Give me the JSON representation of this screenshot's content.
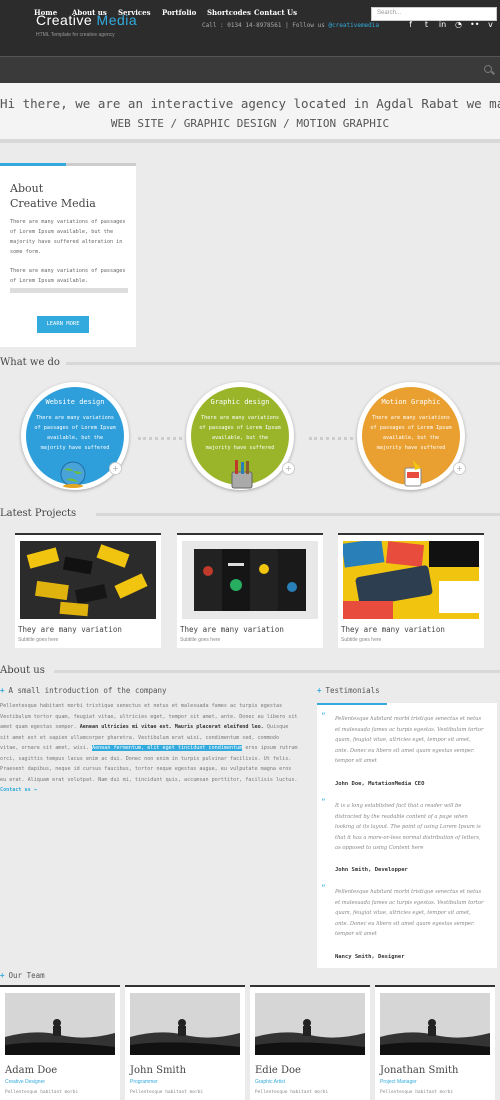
{
  "header": {
    "logo_word1": "Creative",
    "logo_word2": " Media",
    "tagline": "HTML Template for creative agency",
    "contact_prefix": "Call : 0134 14-8978561 | Follow us ",
    "contact_link": "@creativemedia",
    "social_icons": [
      "facebook-icon",
      "twitter-icon",
      "linkedin-icon",
      "rss-icon",
      "flickr-icon",
      "vimeo-icon"
    ]
  },
  "nav": {
    "items": [
      "Home",
      "About us",
      "Services",
      "Portfolio",
      "Shortcodes",
      "Contact Us"
    ],
    "search_placeholder": "Search..."
  },
  "hero": {
    "line1": "Hi there, we are an interactive agency located in Agdal Rabat we make",
    "line2": "WEB SITE / GRAPHIC DESIGN / MOTION GRAPHIC"
  },
  "about_box": {
    "title_line1": "About",
    "title_line2": "Creative Media",
    "text1": "There are many variations of passages of Lorem Ipsum available, but the majority have suffered alteration in some form.",
    "text2": "There are many variations of passages of Lorem Ipsum available.",
    "button": "LEARN MORE"
  },
  "what_we_do": {
    "heading": "What we do",
    "services": [
      {
        "title": "Website design",
        "text": "There are many variations of passages of Lorem Ipsum available, but the majority have suffered",
        "color": "#2f9fdb",
        "icon": "globe-icon"
      },
      {
        "title": "Graphic design",
        "text": "There are many variations of passages of Lorem Ipsum available, but the majority have suffered",
        "color": "#9ab52a",
        "icon": "brush-icon"
      },
      {
        "title": "Motion Graphic",
        "text": "There are many variations of passages of Lorem Ipsum available, but the majority have suffered",
        "color": "#e9a030",
        "icon": "paint-bucket-icon"
      }
    ]
  },
  "projects": {
    "heading": "Latest Projects",
    "items": [
      {
        "title": "They are many variation",
        "subtitle": "Subtitle goes here"
      },
      {
        "title": "They are many variation",
        "subtitle": "Subtitle goes here"
      },
      {
        "title": "They are many variation",
        "subtitle": "Subtitle goes here"
      }
    ]
  },
  "about_us": {
    "heading": "About us",
    "intro_heading": "A small introduction of the company",
    "para_part1": "Pellentesque habitant morbi tristique senectus et netus et malesuada fames ac turpis egestas Vestibulum tortor quam, feugiat vitae, ultricies eget, tempor sit amet, ante. Donec eu libero sit amet quam egestas semper. ",
    "para_bold": "Aenean ultricies mi vitae est. Mauris placerat eleifend leo.",
    "para_part2": " Quisque sit amet est et sapien ullamcorper pharetra. Vestibulum erat wisi, condimentum sed, commodo vitae, ornare sit amet, wisi. ",
    "para_highlight": "Aenean fermentum, elit eget tincidunt condimentum",
    "para_part3": " eros ipsum rutrum orci, sagittis tempus lacus enim ac dui. Donec non enim in turpis pulvinar facilisis. Ut felis. Praesent dapibus, neque id cursus faucibus, tortor neque egestas augue, eu vulputate magna eros eu erat. Aliquam erat volutpat. Nam dui mi, tincidunt quis, accumsan porttitor, facilisis luctus. ",
    "para_link": "Contact us →",
    "testimonials_heading": "Testimonials",
    "testimonials": [
      {
        "quote": "Pellentesque habitant morbi tristique senectus et netus et malesuada fames ac turpis egestas. Vestibulum tortor quam, feugiat vitae, ultricies eget, tempor sit amet, ante. Donec eu libero sit amet quam egestas semper. tempor sit amet",
        "author": "John Doe, MutationMedia CEO"
      },
      {
        "quote": "It is a long established fact that a reader will be distracted by the readable content of a page when looking at its layout. The point of using Lorem Ipsum is that it has a more-or-less normal distribution of letters, as opposed to using Content here",
        "author": "John Smith, Developper"
      },
      {
        "quote": "Pellentesque habitant morbi tristique senectus et netus et malesuada fames ac turpis egestas. Vestibulum tortor quam, feugiat vitae, ultricies eget, tempor sit amet, ante. Donec eu libero sit amet quam egestas semper. tempor sit amet",
        "author": "Nancy Smith, Designer"
      }
    ]
  },
  "team": {
    "heading": "Our Team",
    "members": [
      {
        "name": "Adam Doe",
        "role": "Creative Designer",
        "text": "Pellentesque habitant morbi"
      },
      {
        "name": "John Smith",
        "role": "Programmer",
        "text": "Pellentesque habitant morbi"
      },
      {
        "name": "Edie Doe",
        "role": "Graphic Artist",
        "text": "Pellentesque habitant morbi"
      },
      {
        "name": "Jonathan Smith",
        "role": "Project Manager",
        "text": "Pellentesque habitant morbi"
      }
    ]
  }
}
